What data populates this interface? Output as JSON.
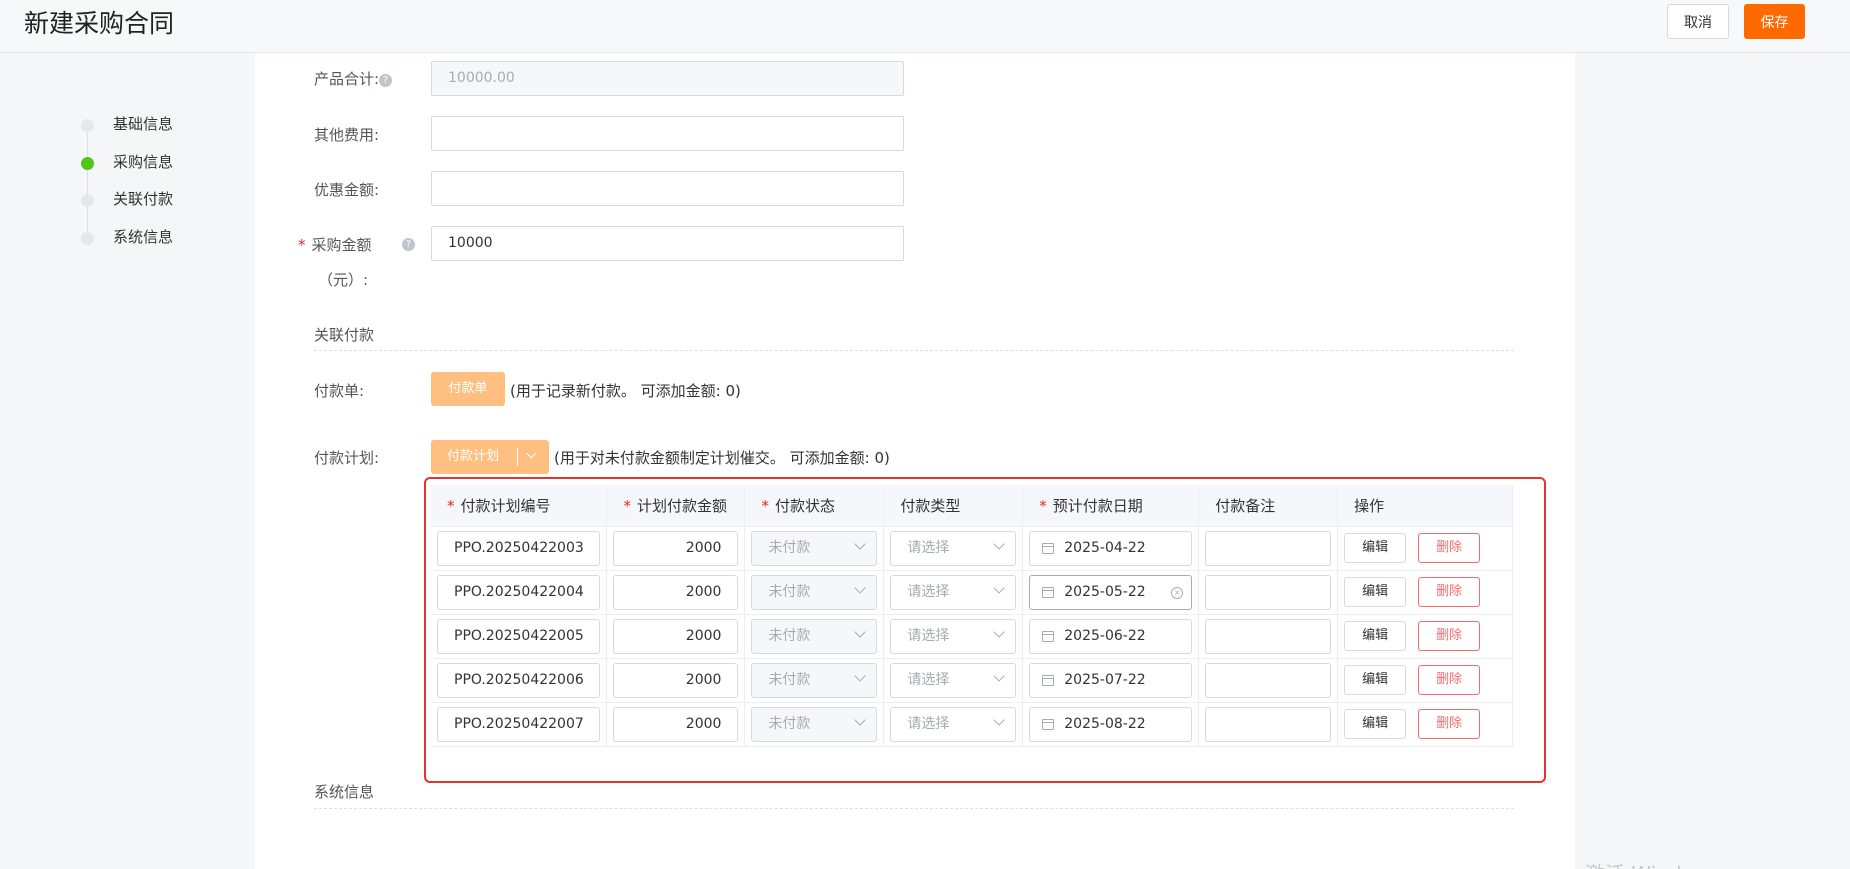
{
  "header": {
    "title": "新建采购合同",
    "cancel_label": "取消",
    "save_label": "保存"
  },
  "steps": [
    {
      "label": "基础信息",
      "active": false
    },
    {
      "label": "采购信息",
      "active": true
    },
    {
      "label": "关联付款",
      "active": false
    },
    {
      "label": "系统信息",
      "active": false
    }
  ],
  "form": {
    "product_total_label": "产品合计:",
    "product_total_value": "10000.00",
    "other_fee_label": "其他费用:",
    "other_fee_value": "",
    "discount_label": "优惠金额:",
    "discount_value": "",
    "purchase_amount_label": "采购金额",
    "purchase_amount_unit": "（元）:",
    "purchase_amount_value": "10000",
    "required_mark": "*",
    "help_mark": "?"
  },
  "payment_section": {
    "title": "关联付款",
    "payment_order_label": "付款单:",
    "payment_order_button": "付款单",
    "payment_order_note": "(用于记录新付款。 可添加金额: 0)",
    "payment_plan_label": "付款计划:",
    "payment_plan_button": "付款计划",
    "payment_plan_note": "(用于对未付款金额制定计划催交。 可添加金额: 0)"
  },
  "plan_table": {
    "columns": [
      "付款计划编号",
      "计划付款金额",
      "付款状态",
      "付款类型",
      "预计付款日期",
      "付款备注",
      "操作"
    ],
    "rows": [
      {
        "code": "PPO.20250422003",
        "amount": "2000",
        "status": "未付款",
        "type": "请选择",
        "date": "2025-04-22",
        "note": "",
        "edit": "编辑",
        "delete": "删除"
      },
      {
        "code": "PPO.20250422004",
        "amount": "2000",
        "status": "未付款",
        "type": "请选择",
        "date": "2025-05-22",
        "note": "",
        "edit": "编辑",
        "delete": "删除"
      },
      {
        "code": "PPO.20250422005",
        "amount": "2000",
        "status": "未付款",
        "type": "请选择",
        "date": "2025-06-22",
        "note": "",
        "edit": "编辑",
        "delete": "删除"
      },
      {
        "code": "PPO.20250422006",
        "amount": "2000",
        "status": "未付款",
        "type": "请选择",
        "date": "2025-07-22",
        "note": "",
        "edit": "编辑",
        "delete": "删除"
      },
      {
        "code": "PPO.20250422007",
        "amount": "2000",
        "status": "未付款",
        "type": "请选择",
        "date": "2025-08-22",
        "note": "",
        "edit": "编辑",
        "delete": "删除"
      }
    ]
  },
  "system_section": {
    "title": "系统信息"
  },
  "watermark": "激活 Windows"
}
